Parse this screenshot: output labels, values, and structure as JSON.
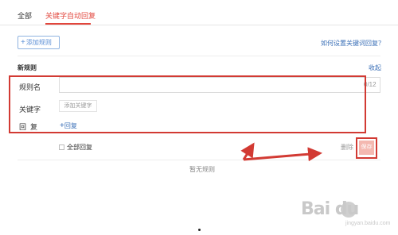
{
  "tabs": [
    {
      "label": "全部"
    },
    {
      "label": "关键字自动回复"
    }
  ],
  "toolbar": {
    "add_rule_label": "添加规则",
    "help_link": "如何设置关键词回复？"
  },
  "rule": {
    "section_title": "新规则",
    "collapse_label": "收起",
    "name_label": "规则名",
    "name_value": "",
    "name_counter": "0/12",
    "keyword_label": "关键字",
    "add_keyword_label": "添加关键字",
    "reply_label": "回复",
    "add_reply_label": "回复",
    "reply_all_label": "全部回复",
    "delete_label": "删除",
    "save_label": "保存"
  },
  "empty_state": "暂无规则",
  "watermark": {
    "logo_text": "Bai du",
    "sub_text": "jingyan.baidu.com"
  },
  "colors": {
    "accent_red": "#e2463c",
    "annotation_red": "#d23a33",
    "link_blue": "#3a6fb7"
  }
}
